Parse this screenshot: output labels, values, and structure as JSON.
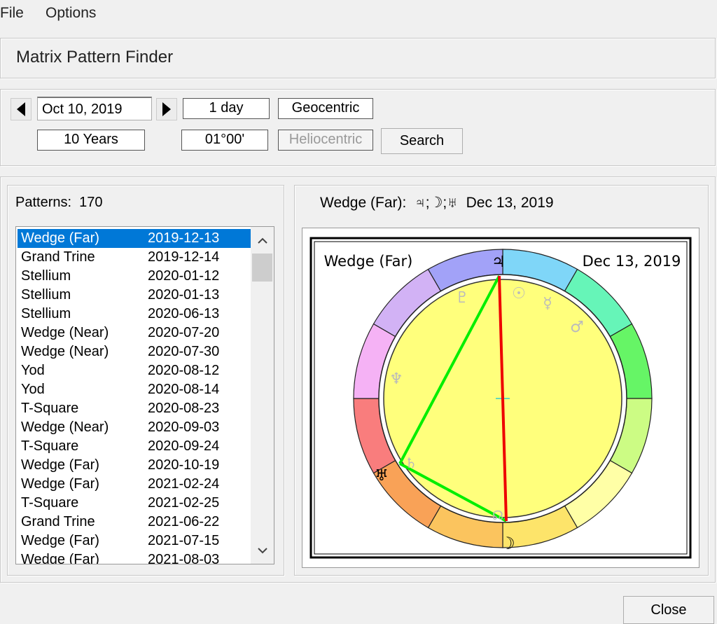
{
  "menu": {
    "file": "File",
    "options": "Options"
  },
  "title": "Matrix Pattern Finder",
  "controls": {
    "date": "Oct 10, 2019",
    "step": "1 day",
    "mode_geo": "Geocentric",
    "range": "10 Years",
    "orb": "01°00'",
    "mode_helio": "Heliocentric",
    "search": "Search"
  },
  "patterns": {
    "label": "Patterns:",
    "count": "170",
    "items": [
      {
        "name": "Wedge (Far)",
        "date": "2019-12-13",
        "selected": true
      },
      {
        "name": "Grand Trine",
        "date": "2019-12-14"
      },
      {
        "name": "Stellium",
        "date": "2020-01-12"
      },
      {
        "name": "Stellium",
        "date": "2020-01-13"
      },
      {
        "name": "Stellium",
        "date": "2020-06-13"
      },
      {
        "name": "Wedge (Near)",
        "date": "2020-07-20"
      },
      {
        "name": "Wedge (Near)",
        "date": "2020-07-30"
      },
      {
        "name": "Yod",
        "date": "2020-08-12"
      },
      {
        "name": "Yod",
        "date": "2020-08-14"
      },
      {
        "name": "T-Square",
        "date": "2020-08-23"
      },
      {
        "name": "Wedge (Near)",
        "date": "2020-09-03"
      },
      {
        "name": "T-Square",
        "date": "2020-09-24"
      },
      {
        "name": "Wedge (Far)",
        "date": "2020-10-19"
      },
      {
        "name": "Wedge (Far)",
        "date": "2021-02-24"
      },
      {
        "name": "T-Square",
        "date": "2021-02-25"
      },
      {
        "name": "Grand Trine",
        "date": "2021-06-22"
      },
      {
        "name": "Wedge (Far)",
        "date": "2021-07-15"
      },
      {
        "name": "Wedge (Far)",
        "date": "2021-08-03"
      }
    ]
  },
  "detail": {
    "header": "Wedge (Far):  ♃;☽;♅  Dec 13, 2019",
    "chart_pattern": "Wedge (Far)",
    "chart_date": "Dec 13, 2019",
    "glyphs": {
      "jupiter": "♃",
      "moon": "☽",
      "uranus": "♅",
      "sun": "☉",
      "mercury": "☿",
      "mars": "♂",
      "neptune": "♆",
      "saturn": "♄",
      "pluto": "♇",
      "node": "☊"
    },
    "sign_colors": [
      "#7fd6f8",
      "#66f5b8",
      "#66f566",
      "#ccfc84",
      "#ffffa6",
      "#fde46a",
      "#fbc45e",
      "#f9a257",
      "#f97d7d",
      "#f5b2f5",
      "#d2b2f5",
      "#a2a2f8"
    ],
    "line_colors": {
      "green": "#00ee00",
      "red": "#ee0000"
    }
  },
  "footer": {
    "close": "Close"
  }
}
